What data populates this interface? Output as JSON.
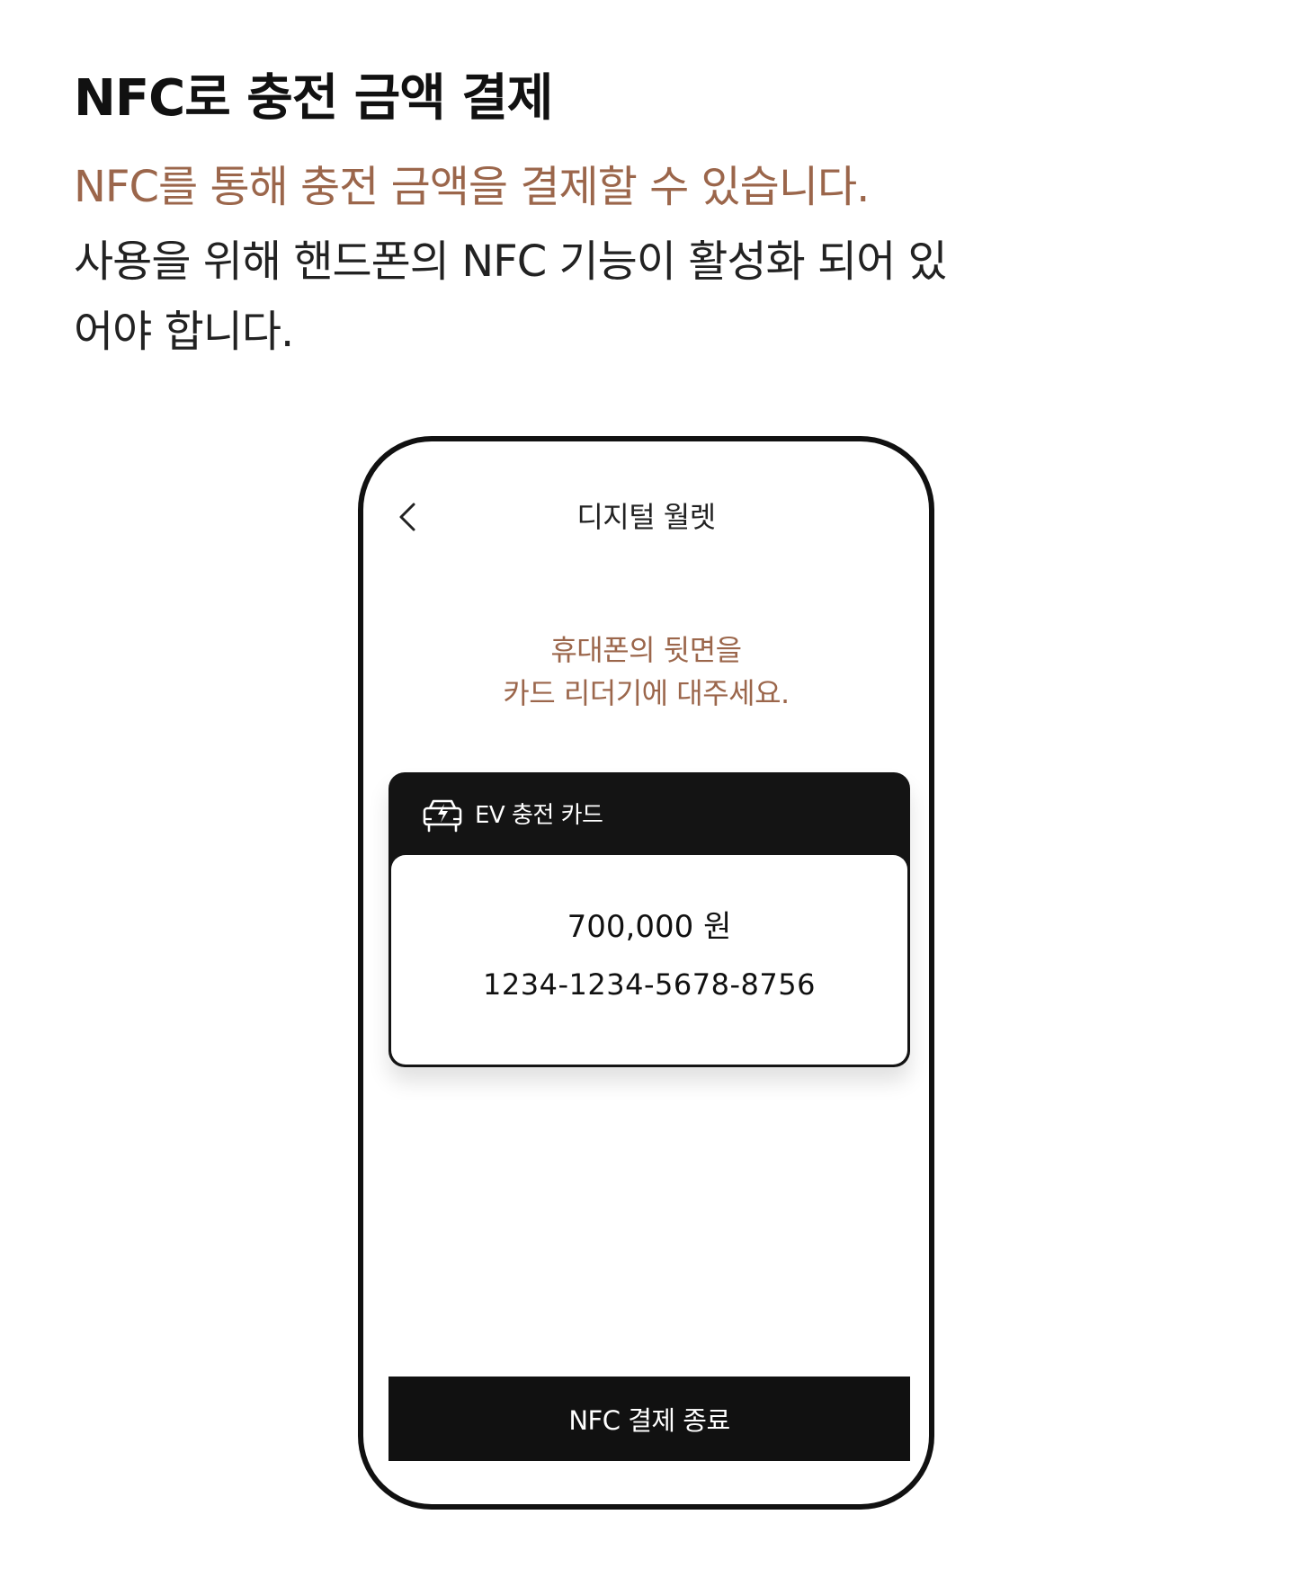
{
  "intro": {
    "heading": "NFC로 충전 금액 결제",
    "accent_line": "NFC를 통해 충전 금액을 결제할 수 있습니다.",
    "description": "사용을 위해 핸드폰의 NFC 기능이 활성화 되어 있어야 합니다."
  },
  "phone": {
    "header": {
      "back_icon": "chevron-left-icon",
      "title": "디지털 월렛"
    },
    "guide": {
      "line1": "휴대폰의 뒷면을",
      "line2": "카드 리더기에 대주세요."
    },
    "card": {
      "icon": "ev-charger-car-icon",
      "label": "EV 충전 카드",
      "amount": "700,000 원",
      "number": "1234-1234-5678-8756"
    },
    "end_button_label": "NFC 결제 종료"
  },
  "colors": {
    "accent": "#9b664b",
    "dark": "#111111",
    "background": "#ffffff"
  }
}
